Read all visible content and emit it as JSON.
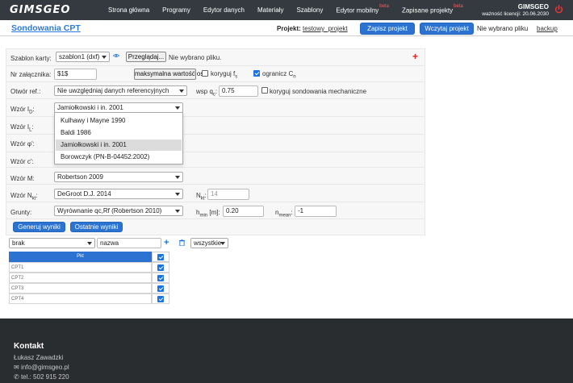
{
  "navbar": {
    "logo": "GIMSGEO",
    "items": [
      {
        "label": "Strona główna",
        "beta": ""
      },
      {
        "label": "Programy",
        "beta": ""
      },
      {
        "label": "Edytor danych",
        "beta": ""
      },
      {
        "label": "Materiały",
        "beta": ""
      },
      {
        "label": "Szablony",
        "beta": ""
      },
      {
        "label": "Edytor mobilny",
        "beta": "beta"
      },
      {
        "label": "Zapisane projekty",
        "beta": "beta"
      }
    ],
    "brand": "GIMSGEO",
    "license": "ważność licencji: 20.06.2030"
  },
  "header": {
    "title": "Sondowania CPT",
    "project_label": "Projekt:",
    "project_name": "testowy_projekt",
    "save_button": "Zapisz projekt",
    "load_button": "Wczytaj projekt",
    "no_file": "Nie wybrano pliku",
    "backup": "backup"
  },
  "form": {
    "template_label": "Szablon karty:",
    "template_value": "szablon1 (dxf)",
    "browse_button": "Przeglądaj...",
    "browse_status": "Nie wybrano pliku.",
    "attachment_label": "Nr załącznika:",
    "attachment_value": "$1$",
    "max_axis_button": "maksymalna wartość osi",
    "corr_fs_label": "koryguj f",
    "corr_fs_sub": "s",
    "limit_cn_label": "ogranicz C",
    "limit_cn_sub": "n",
    "borehole_label": "Otwór ref.:",
    "borehole_value": "Nie uwzględniaj danych referencyjnych",
    "wsp_label": "wsp q",
    "wsp_sub": "c",
    "wsp_suffix": ":",
    "wsp_value": "0.75",
    "corr_mech_label": "koryguj sondowania mechaniczne",
    "id_label": "Wzór I",
    "id_sub": "D",
    "id_value": "Jamiołkowski i in. 2001",
    "il_label": "Wzór I",
    "il_sub": "L",
    "phi_label": "Wzór φ':",
    "c_label": "Wzór c':",
    "m_label": "Wzór M:",
    "m_value": "Robertson 2009",
    "nkt_label": "Wzór N",
    "nkt_sub": "kt",
    "nkt_value": "DeGroot D.J. 2014",
    "nkt_field_label": "N",
    "nkt_field_sub": "kt",
    "nkt_field_placeholder": "14",
    "soils_label": "Grunty:",
    "soils_value": "Wyrównanie qc,Rf (Robertson 2010)",
    "hmin_label": "h",
    "hmin_sub": "min",
    "hmin_unit": " [m]:",
    "hmin_value": "0.20",
    "nmean_label": "n",
    "nmean_sub": "mean",
    "nmean_suffix": ":",
    "nmean_value": "-1",
    "dropdown_options": [
      "Kulhawy i Mayne 1990",
      "Baldi 1986",
      "Jamiołkowski i in. 2001",
      "Borowczyk (PN-B-04452:2002)"
    ],
    "dropdown_selected": 2
  },
  "actions": {
    "generate": "Generuj wyniki",
    "last": "Ostatnie wyniki"
  },
  "filter": {
    "select_value": "brak",
    "name_value": "nazwa",
    "scope_value": "wszystkie"
  },
  "table": {
    "header": "Pkt",
    "rows": [
      "CPT1",
      "CPT2",
      "CPT3",
      "CPT4"
    ]
  },
  "footer": {
    "title": "Kontakt",
    "name": "Łukasz Zawadzki",
    "email": "info@gimsgeo.pl",
    "phone": "tel.: 502 915 220"
  },
  "colors": {
    "navbar": "#343a40",
    "accent": "#2c72d0",
    "footer": "#2a2d30",
    "danger": "#e02020"
  }
}
